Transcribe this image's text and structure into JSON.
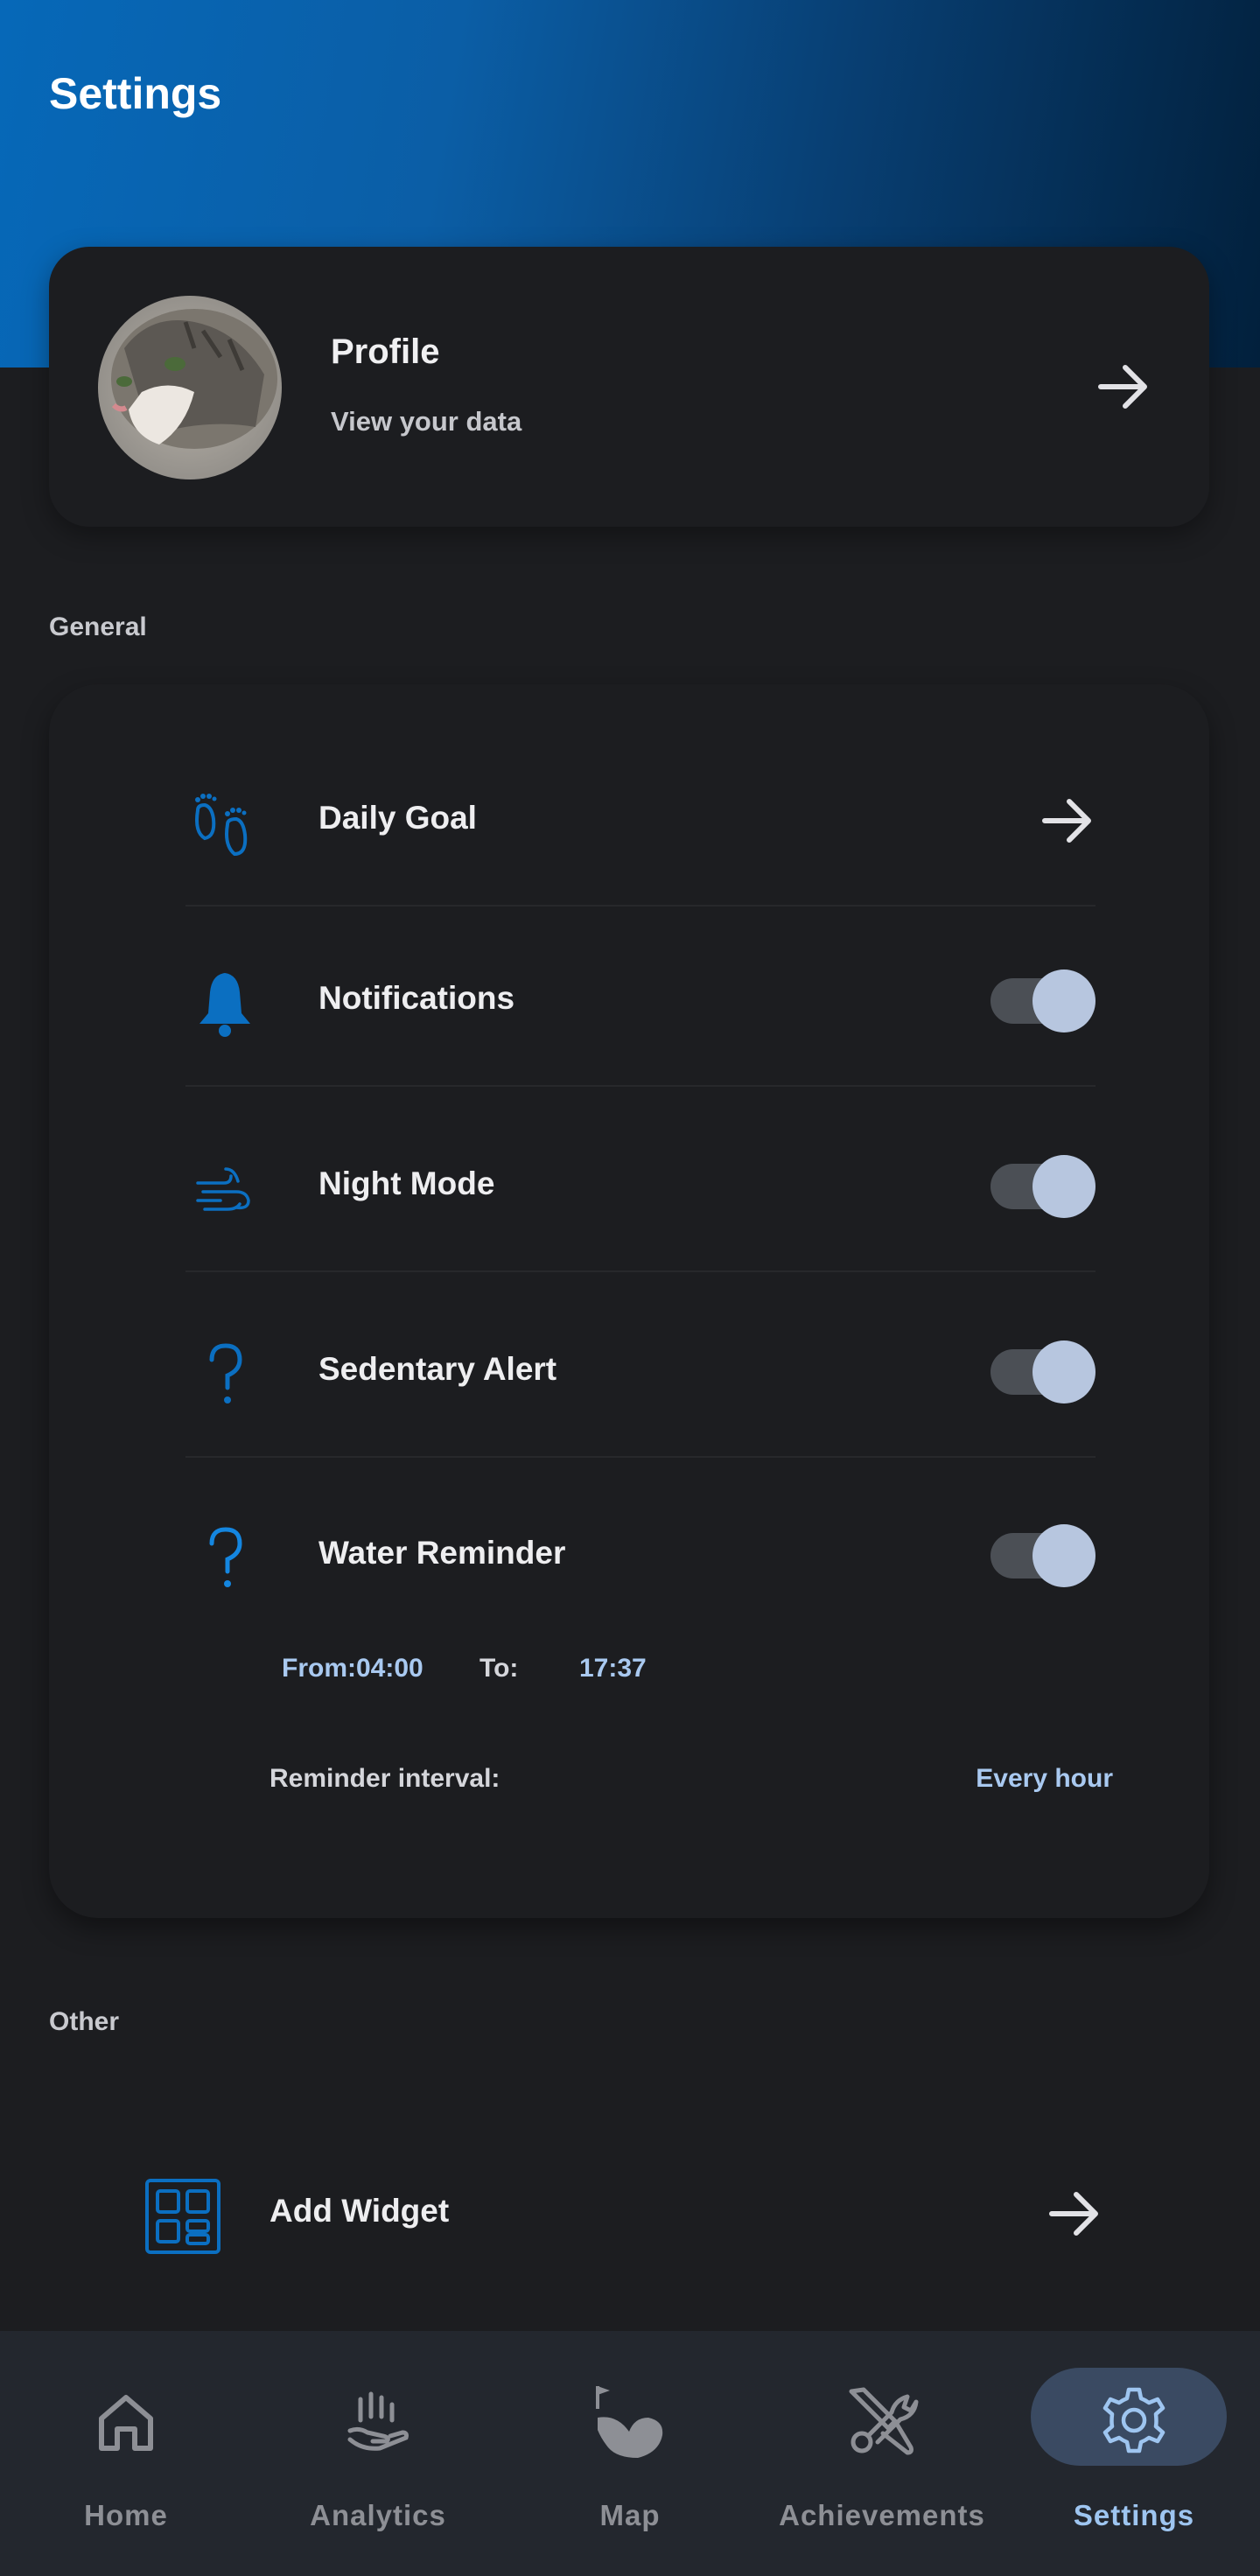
{
  "header": {
    "title": "Settings"
  },
  "profile": {
    "title": "Profile",
    "subtitle": "View your data",
    "avatar": "cat-photo"
  },
  "general": {
    "section_label": "General",
    "items": [
      {
        "label": "Daily Goal",
        "icon": "footprints-icon",
        "control": "arrow"
      },
      {
        "label": "Notifications",
        "icon": "bell-icon",
        "control": "toggle",
        "enabled": true
      },
      {
        "label": "Night Mode",
        "icon": "wind-icon",
        "control": "toggle",
        "enabled": true
      },
      {
        "label": "Sedentary Alert",
        "icon": "question-icon",
        "control": "toggle",
        "enabled": true
      },
      {
        "label": "Water Reminder",
        "icon": "question-icon",
        "control": "toggle",
        "enabled": true
      }
    ],
    "water": {
      "from_text": "From:04:00",
      "to_label": "To:",
      "to_value": "17:37",
      "interval_label": "Reminder interval:",
      "interval_value": "Every hour"
    }
  },
  "other": {
    "section_label": "Other",
    "items": [
      {
        "label": "Add Widget",
        "icon": "widget-grid-icon",
        "control": "arrow"
      }
    ]
  },
  "nav": {
    "items": [
      {
        "label": "Home",
        "icon": "home-icon",
        "active": false
      },
      {
        "label": "Analytics",
        "icon": "hand-chart-icon",
        "active": false
      },
      {
        "label": "Map",
        "icon": "route-flag-icon",
        "active": false
      },
      {
        "label": "Achievements",
        "icon": "tools-icon",
        "active": false
      },
      {
        "label": "Settings",
        "icon": "gear-icon",
        "active": true
      }
    ]
  },
  "colors": {
    "accent": "#0b6fc1",
    "background": "#1c1d20",
    "active_text": "#9ec5f0",
    "toggle_thumb": "#b7c6df"
  }
}
